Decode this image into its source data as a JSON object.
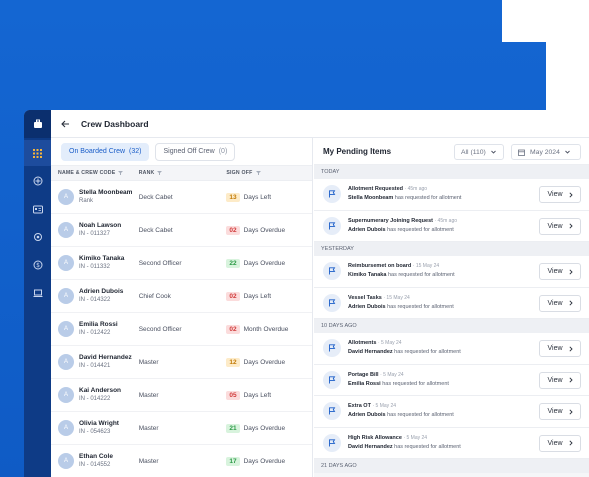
{
  "header": {
    "title": "Crew Dashboard"
  },
  "tabs": [
    {
      "label": "On Boarded Crew",
      "count": "(32)"
    },
    {
      "label": "Signed Off Crew",
      "count": "(0)"
    }
  ],
  "table": {
    "columns": [
      "NAME & CREW CODE",
      "RANK",
      "SIGN OFF"
    ],
    "rows": [
      {
        "initial": "A",
        "name": "Stella Moonbeam",
        "code": "Rank",
        "rank": "Deck Cabet",
        "days": "13",
        "status": "Days Left",
        "tone": "orange"
      },
      {
        "initial": "A",
        "name": "Noah Lawson",
        "code": "IN - 011327",
        "rank": "Deck Cabet",
        "days": "02",
        "status": "Days Overdue",
        "tone": "red"
      },
      {
        "initial": "A",
        "name": "Kimiko Tanaka",
        "code": "IN - 011332",
        "rank": "Second Officer",
        "days": "22",
        "status": "Days Overdue",
        "tone": "green"
      },
      {
        "initial": "A",
        "name": "Adrien Dubois",
        "code": "IN - 014322",
        "rank": "Chief Cook",
        "days": "02",
        "status": "Days Left",
        "tone": "red"
      },
      {
        "initial": "A",
        "name": "Emilia Rossi",
        "code": "IN - 012422",
        "rank": "Second Officer",
        "days": "02",
        "status": "Month Overdue",
        "tone": "red"
      },
      {
        "initial": "A",
        "name": "David Hernandez",
        "code": "IN - 014421",
        "rank": "Master",
        "days": "12",
        "status": "Days Overdue",
        "tone": "orange"
      },
      {
        "initial": "A",
        "name": "Kai Anderson",
        "code": "IN - 014222",
        "rank": "Master",
        "days": "05",
        "status": "Days Left",
        "tone": "red"
      },
      {
        "initial": "A",
        "name": "Olivia Wright",
        "code": "IN - 054623",
        "rank": "Master",
        "days": "21",
        "status": "Days Overdue",
        "tone": "green"
      },
      {
        "initial": "A",
        "name": "Ethan Cole",
        "code": "IN - 014552",
        "rank": "Master",
        "days": "17",
        "status": "Days Overdue",
        "tone": "green"
      }
    ]
  },
  "pending": {
    "title": "My Pending Items",
    "filter": "All (110)",
    "month": "May 2024",
    "view_label": "View",
    "sections": [
      {
        "label": "TODAY",
        "items": [
          {
            "title": "Allotment Requested",
            "ago": "· 45m ago",
            "who": "Stella Moonbeam",
            "text": "has requested for allotment"
          },
          {
            "title": "Supernumerary Joining Request",
            "ago": "· 45m ago",
            "who": "Adrien Dubois",
            "text": "has requested for allotment"
          }
        ]
      },
      {
        "label": "YESTERDAY",
        "items": [
          {
            "title": "Reimbursemet on board",
            "ago": "· 15 May 24",
            "who": "Kimiko Tanaka",
            "text": "has requested for allotment"
          },
          {
            "title": "Vessel Tasks",
            "ago": "· 15 May 24",
            "who": "Adrien Dubois",
            "text": "has requested for allotment"
          }
        ]
      },
      {
        "label": "10 DAYS AGO",
        "items": [
          {
            "title": "Allotments",
            "ago": "· 5 May 24",
            "who": "David Hernandez",
            "text": "has requested for allotment"
          },
          {
            "title": "Portage Bill",
            "ago": "· 5 May 24",
            "who": "Emilia Rossi",
            "text": "has requested for allotment"
          },
          {
            "title": "Extra OT",
            "ago": "· 5 May 24",
            "who": "Adrien Dubois",
            "text": "has requested for allotment"
          },
          {
            "title": "High Risk Allowance",
            "ago": "· 5 May 24",
            "who": "David Hernandez",
            "text": "has requested for allotment"
          }
        ]
      },
      {
        "label": "21 DAYS AGO",
        "items": []
      }
    ]
  },
  "colors": {
    "brand": "#1466d2",
    "rail": "#0e3b86",
    "accent": "#1a5dc8"
  }
}
